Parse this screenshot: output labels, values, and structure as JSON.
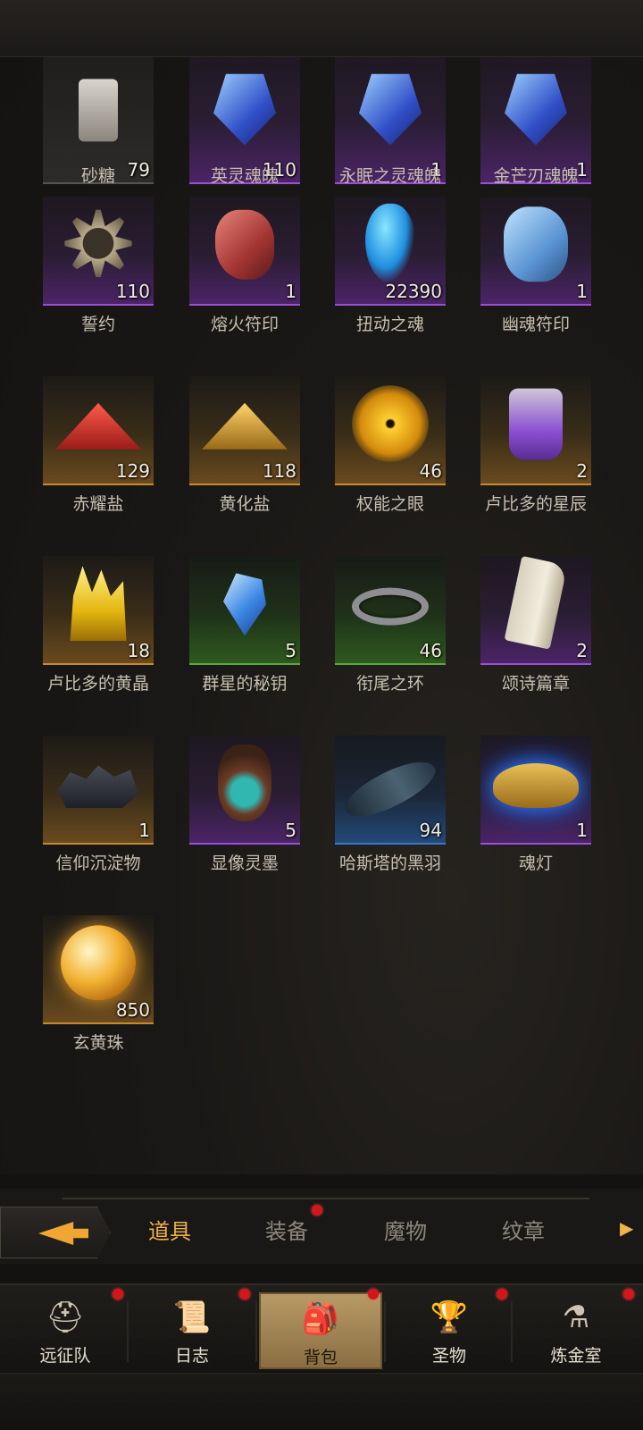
{
  "items": [
    {
      "name": "砂糖",
      "count": "79",
      "rarity": "gray",
      "icon": "sugar-bottle-icon",
      "art": "bottle-top"
    },
    {
      "name": "英灵魂魄",
      "count": "110",
      "rarity": "purple",
      "icon": "hero-soul-crystal-icon",
      "art": "crystal"
    },
    {
      "name": "永眠之灵魂魄",
      "count": "1",
      "rarity": "purple",
      "icon": "eternal-sleep-soul-crystal-icon",
      "art": "crystal"
    },
    {
      "name": "金芒刃魂魄",
      "count": "1",
      "rarity": "purple",
      "icon": "golden-blade-soul-crystal-icon",
      "art": "crystal"
    },
    {
      "name": "誓约",
      "count": "110",
      "rarity": "purple",
      "icon": "oath-star-badge-icon",
      "art": "star-badge"
    },
    {
      "name": "熔火符印",
      "count": "1",
      "rarity": "purple",
      "icon": "molten-fire-rune-icon",
      "art": "rune-red"
    },
    {
      "name": "扭动之魂",
      "count": "22390",
      "rarity": "purple",
      "icon": "twisting-soul-wisp-icon",
      "art": "wisp"
    },
    {
      "name": "幽魂符印",
      "count": "1",
      "rarity": "purple",
      "icon": "ghost-rune-icon",
      "art": "rune-blue"
    },
    {
      "name": "赤耀盐",
      "count": "129",
      "rarity": "gold",
      "icon": "red-salt-pile-icon",
      "art": "pile-red"
    },
    {
      "name": "黄化盐",
      "count": "118",
      "rarity": "gold",
      "icon": "yellow-salt-pile-icon",
      "art": "pile-gold"
    },
    {
      "name": "权能之眼",
      "count": "46",
      "rarity": "gold",
      "icon": "eye-of-authority-icon",
      "art": "eye"
    },
    {
      "name": "卢比多的星辰",
      "count": "2",
      "rarity": "gold",
      "icon": "star-potion-icon",
      "art": "potion"
    },
    {
      "name": "卢比多的黄晶",
      "count": "18",
      "rarity": "gold",
      "icon": "yellow-crystal-icon",
      "art": "gold-crystal"
    },
    {
      "name": "群星的秘钥",
      "count": "5",
      "rarity": "green",
      "icon": "star-key-gem-icon",
      "art": "gem-blue"
    },
    {
      "name": "衔尾之环",
      "count": "46",
      "rarity": "green",
      "icon": "ouroboros-ring-icon",
      "art": "ring"
    },
    {
      "name": "颂诗篇章",
      "count": "2",
      "rarity": "purple",
      "icon": "hymn-scroll-icon",
      "art": "scroll"
    },
    {
      "name": "信仰沉淀物",
      "count": "1",
      "rarity": "gold",
      "icon": "faith-sediment-rocks-icon",
      "art": "rocks"
    },
    {
      "name": "显像灵墨",
      "count": "5",
      "rarity": "purple",
      "icon": "spirit-ink-vase-icon",
      "art": "vase"
    },
    {
      "name": "哈斯塔的黑羽",
      "count": "94",
      "rarity": "blue",
      "icon": "black-feather-icon",
      "art": "feather"
    },
    {
      "name": "魂灯",
      "count": "1",
      "rarity": "purple",
      "icon": "soul-lamp-icon",
      "art": "lamp"
    },
    {
      "name": "玄黄珠",
      "count": "850",
      "rarity": "gold",
      "icon": "golden-orb-icon",
      "art": "orb"
    }
  ],
  "tabs": {
    "back_icon": "back-arrow-icon",
    "items": [
      {
        "label": "道具",
        "active": true,
        "dot": false
      },
      {
        "label": "装备",
        "active": false,
        "dot": true
      },
      {
        "label": "魔物",
        "active": false,
        "dot": false
      },
      {
        "label": "纹章",
        "active": false,
        "dot": false
      }
    ],
    "more_icon": "chevron-right-icon",
    "more_glyph": "▶"
  },
  "nav": [
    {
      "label": "远征队",
      "icon": "viking-helmet-icon",
      "glyph": "⛑",
      "active": false,
      "dot": true
    },
    {
      "label": "日志",
      "icon": "journal-scroll-icon",
      "glyph": "📜",
      "active": false,
      "dot": true
    },
    {
      "label": "背包",
      "icon": "backpack-icon",
      "glyph": "🎒",
      "active": true,
      "dot": true
    },
    {
      "label": "圣物",
      "icon": "chalice-icon",
      "glyph": "🏆",
      "active": false,
      "dot": true
    },
    {
      "label": "炼金室",
      "icon": "alchemy-icon",
      "glyph": "⚗",
      "active": false,
      "dot": true
    }
  ],
  "colors": {
    "accent": "#f0b24a",
    "notify_dot": "#d4161b",
    "rarity_purple": "#9a4fd6",
    "rarity_gold": "#c58a2f",
    "rarity_green": "#5aa83a",
    "rarity_blue": "#3b77c6"
  }
}
